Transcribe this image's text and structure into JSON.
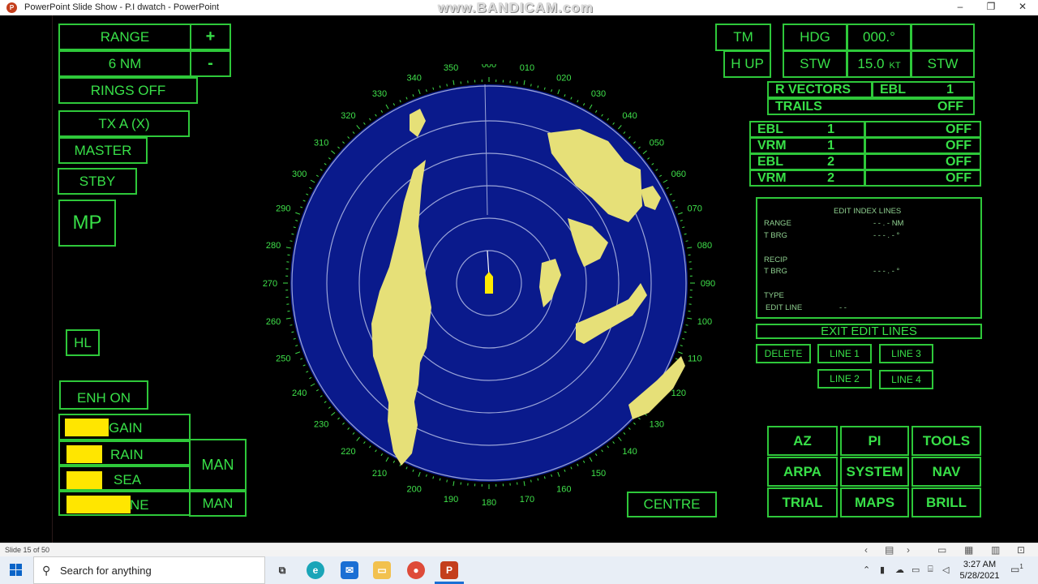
{
  "window": {
    "title": "PowerPoint Slide Show  -  P.I dwatch - PowerPoint",
    "watermark": "www.BANDICAM.com",
    "minimize": "–",
    "restore": "❐",
    "close": "✕"
  },
  "left_panel": {
    "range_label": "RANGE",
    "range_plus": "+",
    "range_value": "6 NM",
    "range_minus": "-",
    "rings": "RINGS OFF",
    "tx": "TX A (X)",
    "master": "MASTER",
    "stby": "STBY",
    "mp": "MP",
    "hl": "HL",
    "enh": "ENH ON",
    "gain": "GAIN",
    "rain": "RAIN",
    "sea": "SEA",
    "tune": "NE",
    "man1": "MAN",
    "man2": "MAN"
  },
  "top_right": {
    "tm": "TM",
    "hup": "H UP",
    "hdg_label": "HDG",
    "hdg_value": "000.°",
    "stw_label": "STW",
    "stw_value": "15.0",
    "stw_unit": "KT",
    "stw_mode": "STW",
    "rvectors": "R VECTORS",
    "ebl_label": "EBL",
    "ebl_num": "1",
    "trails": "TRAILS",
    "trails_value": "OFF"
  },
  "ebl_vrm": [
    {
      "name": "EBL",
      "num": "1",
      "state": "OFF"
    },
    {
      "name": "VRM",
      "num": "1",
      "state": "OFF"
    },
    {
      "name": "EBL",
      "num": "2",
      "state": "OFF"
    },
    {
      "name": "VRM",
      "num": "2",
      "state": "OFF"
    }
  ],
  "edit_index": {
    "heading": "EDIT INDEX LINES",
    "range_label": "RANGE",
    "range_value": "- - . -  NM",
    "tbrg_label": "T BRG",
    "tbrg_value": "- - - . - °",
    "recip_label": "RECIP",
    "tbrg2_label": "T BRG",
    "tbrg2_value": "- - - . - °",
    "type_label": "TYPE",
    "editline_label": "EDIT LINE",
    "editline_value": "- -"
  },
  "edit_buttons": {
    "exit": "EXIT EDIT LINES",
    "delete": "DELETE",
    "line1": "LINE 1",
    "line2": "LINE 2",
    "line3": "LINE 3",
    "line4": "LINE 4"
  },
  "menu_buttons": {
    "az": "AZ",
    "pi": "PI",
    "tools": "TOOLS",
    "arpa": "ARPA",
    "system": "SYSTEM",
    "nav": "NAV",
    "trial": "TRIAL",
    "maps": "MAPS",
    "brill": "BRILL"
  },
  "centre": "CENTRE",
  "radar": {
    "bearings": [
      "000",
      "010",
      "020",
      "030",
      "040",
      "050",
      "060",
      "070",
      "080",
      "090",
      "100",
      "110",
      "120",
      "130",
      "140",
      "150",
      "160",
      "170",
      "180",
      "190",
      "200",
      "210",
      "220",
      "230",
      "240",
      "250",
      "260",
      "270",
      "280",
      "290",
      "300",
      "310",
      "320",
      "330",
      "340",
      "350"
    ],
    "colors": {
      "sea": "#0a1a8c",
      "land": "#e6e078",
      "own_ship": "#ffea00",
      "scale": "#3fe04a"
    }
  },
  "status": {
    "slide": "Slide 15 of 50"
  },
  "taskbar": {
    "search_placeholder": "Search for anything",
    "time": "3:27 AM",
    "date": "5/28/2021",
    "notification_count": "1"
  }
}
